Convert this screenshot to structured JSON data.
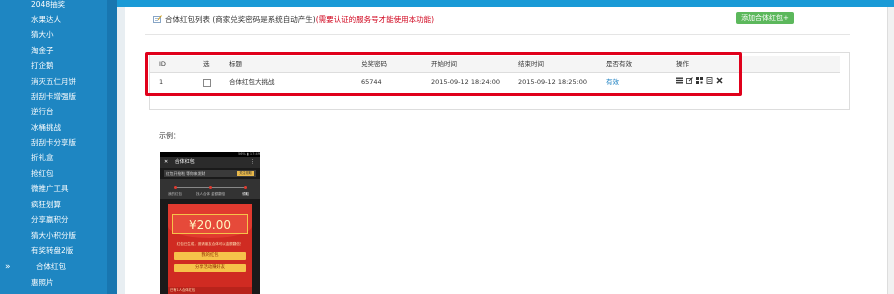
{
  "sidebar": {
    "items": [
      "2048抽奖",
      "水果达人",
      "猜大小",
      "淘金子",
      "打企鹅",
      "消灭五仁月饼",
      "刮刮卡增强版",
      "逆行台",
      "冰桶挑战",
      "刮刮卡分享版",
      "折礼盒",
      "抢红包",
      "微推广工具",
      "疯狂划算",
      "分享赢积分",
      "猜大小积分版",
      "有奖转盘2版",
      "合体红包",
      "惠照片"
    ],
    "active_marker": "»"
  },
  "page": {
    "title": "合体红包列表 (商家兑奖密码是系统自动产生)",
    "warning": "(需要认证的服务号才能使用本功能)",
    "add_button": "添加合体红包+"
  },
  "table": {
    "headers": [
      "ID",
      "选",
      "标题",
      "兑奖密码",
      "开始时间",
      "结束时间",
      "是否有效",
      "操作"
    ],
    "row": {
      "id": "1",
      "title": "合体红包大挑战",
      "password": "65744",
      "start": "2015-09-12 18:24:00",
      "end": "2015-09-12 18:25:00",
      "valid": "有效"
    },
    "op_icons": [
      "list-icon",
      "edit-icon",
      "qrcode-icon",
      "document-icon",
      "delete-icon"
    ]
  },
  "example": {
    "label": "示例：",
    "phone": {
      "status": "56% ▮ 17:49",
      "nav_title": "合体红包",
      "banner": "红包开抢啦 等你来发财",
      "banner_tag": "关注领取",
      "steps": [
        "我的红包",
        "找人合体 金额翻倍",
        "领取"
      ],
      "amount": "¥20.00",
      "message": "红包已生成，邀请朋友合体可以金额翻倍！",
      "btn1": "我的红包",
      "btn2": "分享活动赚好友",
      "footer": "已有1人合体红包"
    }
  },
  "colors": {
    "sidebar": "#1e86c2",
    "topbar": "#1a9ad6",
    "highlight": "#e0001b",
    "warn": "#d0021b",
    "add_button": "#5cb85c",
    "link": "#1a7fc1"
  }
}
